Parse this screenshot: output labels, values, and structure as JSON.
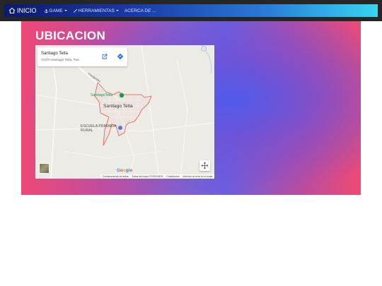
{
  "navbar": {
    "brand": "INICIO",
    "items": [
      {
        "label": "GAME",
        "icon": "anchor-icon",
        "dropdown": true
      },
      {
        "label": "HERRAMIENTAS",
        "icon": "wrench-icon",
        "dropdown": true
      },
      {
        "label": "ACERCA DE ...",
        "icon": "",
        "dropdown": false
      }
    ]
  },
  "hero": {
    "title": "UBICACION"
  },
  "map": {
    "place_name": "Santiago Tetla",
    "place_address": "74370 Santiago Tetla, Pue.",
    "town_label": "Santiago Tetla",
    "poi_green": "SantiagoTetla",
    "poi_school": "ESCUELA PRIMARIA RURAL",
    "road_label": "Insurgentes",
    "google": [
      "G",
      "o",
      "o",
      "g",
      "l",
      "e"
    ],
    "attribution": [
      "Combinaciones de teclas",
      "Datos del mapa ©2026 INEGI",
      "Condiciones",
      "Informar un error en el mapa"
    ]
  },
  "colors": {
    "nav_start": "#0b1a6b",
    "nav_end": "#36d4f0",
    "hero_pink": "#ef4876",
    "hero_blue": "#5a5ae8",
    "boundary": "#e8584a"
  }
}
